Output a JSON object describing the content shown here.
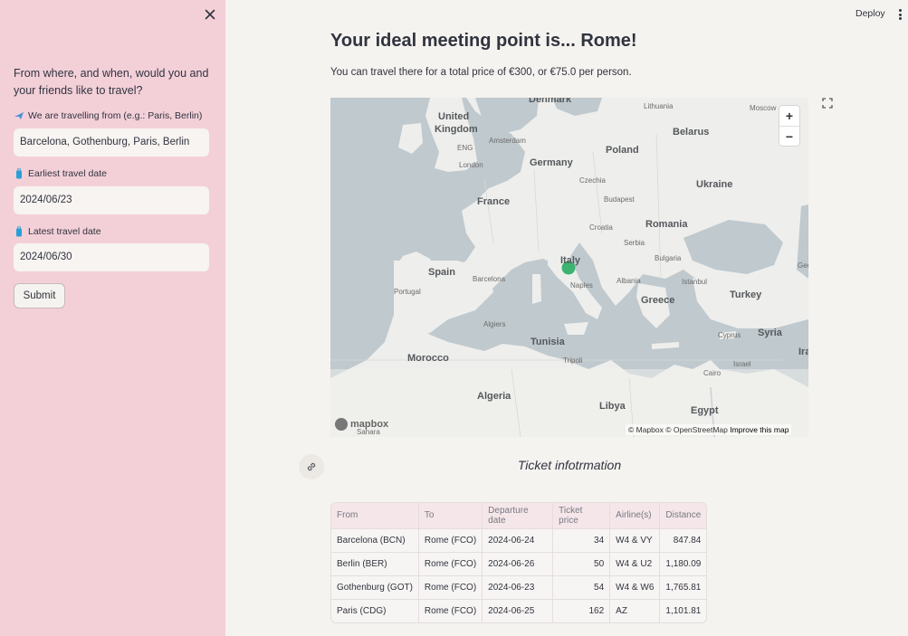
{
  "sidebar": {
    "question": "From where, and when, would you and your friends like to travel?",
    "from_label": "We are travelling from (e.g.: Paris, Berlin)",
    "from_value": "Barcelona, Gothenburg, Paris, Berlin",
    "earliest_label": "Earliest travel date",
    "earliest_value": "2024/06/23",
    "latest_label": "Latest travel date",
    "latest_value": "2024/06/30",
    "submit_label": "Submit"
  },
  "header": {
    "deploy_label": "Deploy"
  },
  "main": {
    "title": "Your ideal meeting point is... Rome!",
    "subtitle": "You can travel there for a total price of €300, or €75.0 per person.",
    "section_title": "Ticket infotrmation"
  },
  "map": {
    "labels": {
      "denmark": "Denmark",
      "lithuania": "Lithuania",
      "moscow": "Moscow",
      "uk": "United Kingdom",
      "eng": "ENG",
      "belarus": "Belarus",
      "amsterdam": "Amsterdam",
      "poland": "Poland",
      "london": "London",
      "germany": "Germany",
      "czechia": "Czechia",
      "ukraine": "Ukraine",
      "france": "France",
      "budapest": "Budapest",
      "croatia": "Croatia",
      "romania": "Romania",
      "serbia": "Serbia",
      "italy": "Italy",
      "bulgaria": "Bulgaria",
      "spain": "Spain",
      "barcelona": "Barcelona",
      "portugal": "Portugal",
      "naples": "Naples",
      "albania": "Albania",
      "istanbul": "Istanbul",
      "greece": "Greece",
      "turkey": "Turkey",
      "algiers": "Algiers",
      "tunisia": "Tunisia",
      "cyprus": "Cyprus",
      "syria": "Syria",
      "morocco": "Morocco",
      "tripoli": "Tripoli",
      "israel": "Israel",
      "cairo": "Cairo",
      "algeria": "Algeria",
      "libya": "Libya",
      "egypt": "Egypt",
      "saharo": "Sahara",
      "ira": "Ira",
      "geo": "Geo"
    },
    "mapbox_logo": "mapbox",
    "attribution": "© Mapbox © OpenStreetMap",
    "improve_link": "Improve this map",
    "zoom_in": "+",
    "zoom_out": "−",
    "marker_color": "#3cb371"
  },
  "table": {
    "headers": [
      "From",
      "To",
      "Departure date",
      "Ticket price",
      "Airline(s)",
      "Distance"
    ],
    "rows": [
      [
        "Barcelona (BCN)",
        "Rome (FCO)",
        "2024-06-24",
        "34",
        "W4 & VY",
        "847.84"
      ],
      [
        "Berlin (BER)",
        "Rome (FCO)",
        "2024-06-26",
        "50",
        "W4 & U2",
        "1,180.09"
      ],
      [
        "Gothenburg (GOT)",
        "Rome (FCO)",
        "2024-06-23",
        "54",
        "W4 & W6",
        "1,765.81"
      ],
      [
        "Paris (CDG)",
        "Rome (FCO)",
        "2024-06-25",
        "162",
        "AZ",
        "1,101.81"
      ]
    ]
  },
  "colors": {
    "sidebar_bg": "#f3d0d8",
    "main_bg": "#f5f3ef",
    "accent": "#3cb371"
  }
}
